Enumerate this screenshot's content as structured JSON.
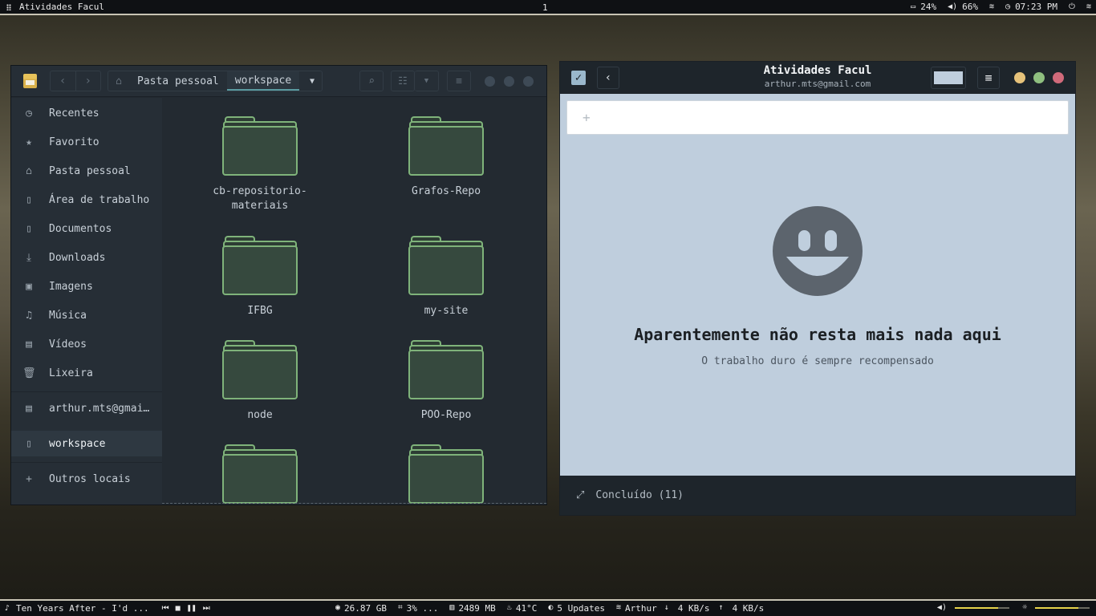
{
  "topbar": {
    "active_window_title": "Atividades Facul",
    "workspace": "1",
    "battery": "24%",
    "volume": "66%",
    "time": "07:23 PM"
  },
  "file_manager": {
    "path": {
      "home": "Pasta pessoal",
      "current": "workspace"
    },
    "sidebar": [
      {
        "label": "Recentes",
        "icon": "clock-icon"
      },
      {
        "label": "Favorito",
        "icon": "star-icon"
      },
      {
        "label": "Pasta pessoal",
        "icon": "home-icon"
      },
      {
        "label": "Área de trabalho",
        "icon": "folder-icon"
      },
      {
        "label": "Documentos",
        "icon": "folder-icon"
      },
      {
        "label": "Downloads",
        "icon": "download-icon"
      },
      {
        "label": "Imagens",
        "icon": "image-icon"
      },
      {
        "label": "Música",
        "icon": "music-icon"
      },
      {
        "label": "Vídeos",
        "icon": "video-icon"
      },
      {
        "label": "Lixeira",
        "icon": "trash-icon"
      },
      {
        "label": "arthur.mts@gmai…",
        "icon": "server-icon"
      },
      {
        "label": "workspace",
        "icon": "folder-icon"
      },
      {
        "label": "Outros locais",
        "icon": "plus-icon"
      }
    ],
    "folders": [
      "cb-repositorio-materiais",
      "Grafos-Repo",
      "IFBG",
      "my-site",
      "node",
      "POO-Repo",
      "",
      ""
    ]
  },
  "tasks": {
    "title": "Atividades Facul",
    "account": "arthur.mts@gmail.com",
    "new_task_placeholder": "",
    "empty_title": "Aparentemente não resta mais nada aqui",
    "empty_subtitle": "O trabalho duro é sempre recompensado",
    "completed": "Concluído (11)",
    "accent_color": "#bfcedd"
  },
  "bottombar": {
    "now_playing": "Ten Years After - I'd ...",
    "disk": "26.87 GB",
    "cpu": "3% ...",
    "memory": "2489 MB",
    "temperature": "41°C",
    "updates": "5 Updates",
    "network_name": "Arthur",
    "download_speed": "4 KB/s",
    "upload_speed": "4 KB/s",
    "volume_level": 0.8,
    "brightness_level": 0.8
  }
}
